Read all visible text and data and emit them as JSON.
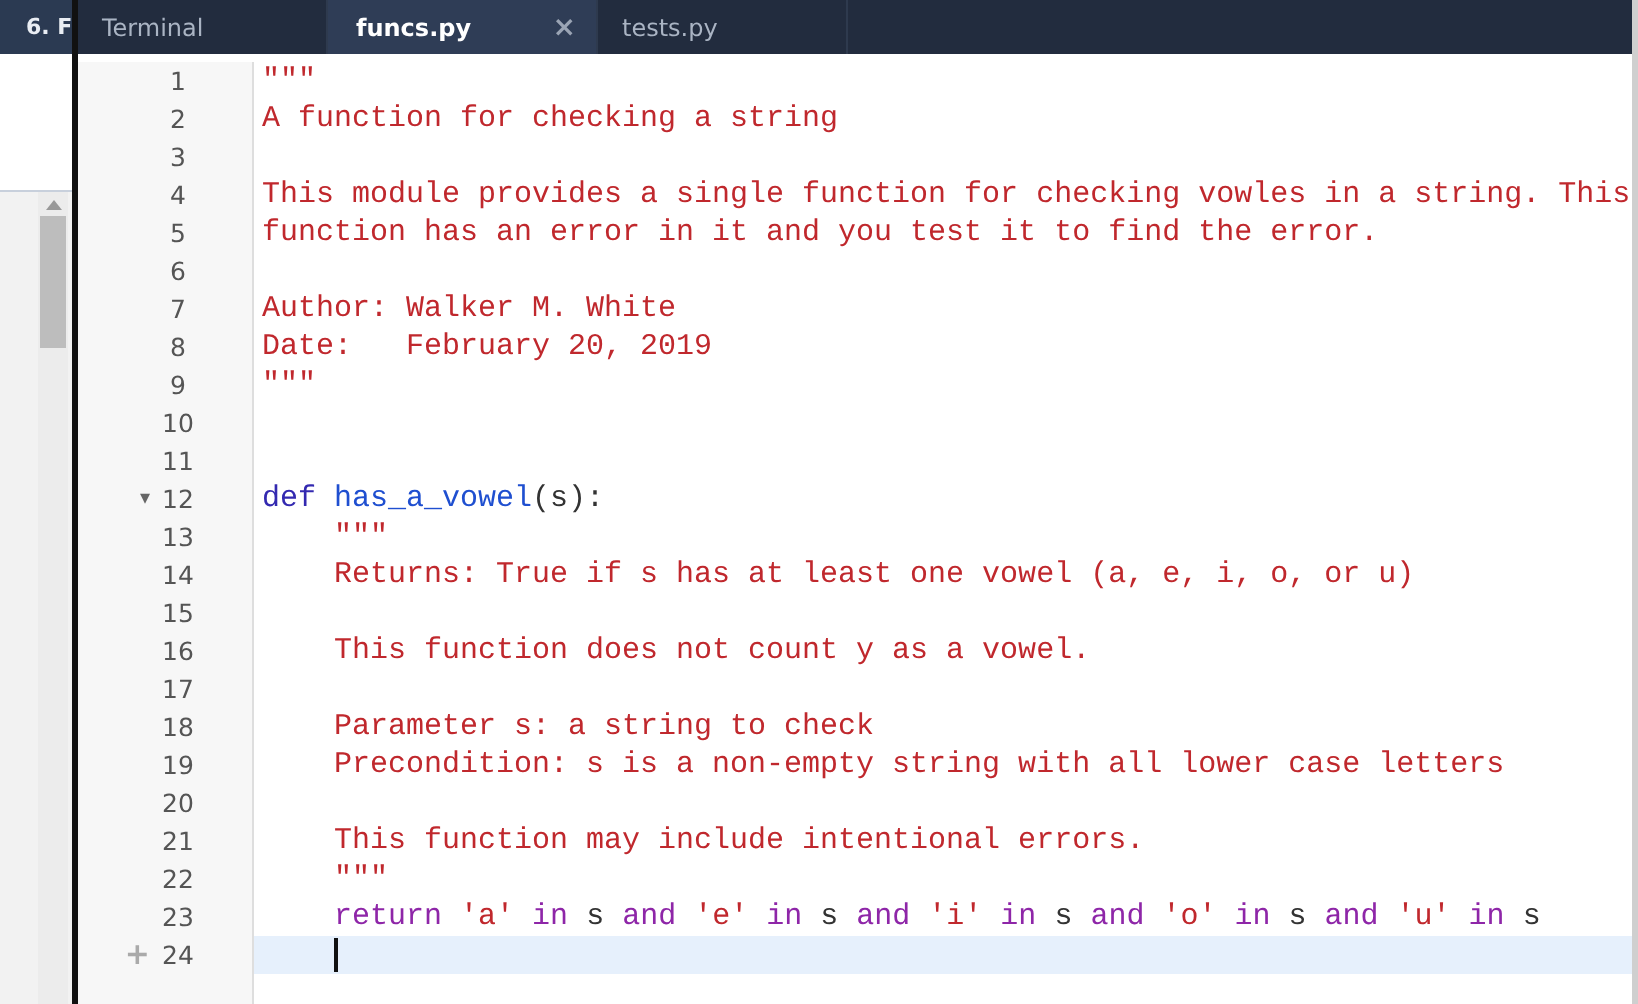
{
  "background_window": {
    "title": "6. F"
  },
  "tabs": [
    {
      "label": "Terminal",
      "selected": false
    },
    {
      "label": "funcs.py",
      "selected": true,
      "close": "×"
    },
    {
      "label": "tests.py",
      "selected": false
    }
  ],
  "lines": [
    {
      "number": "1",
      "current": false,
      "tokens": [
        {
          "kind": "string",
          "text": "\"\"\""
        }
      ]
    },
    {
      "number": "2",
      "current": false,
      "tokens": [
        {
          "kind": "string",
          "text": "A function for checking a string"
        }
      ]
    },
    {
      "number": "3",
      "current": false
    },
    {
      "number": "4",
      "current": false,
      "tokens": [
        {
          "kind": "string",
          "text": "This module provides a single function for checking vowles in a string. This"
        }
      ]
    },
    {
      "number": "5",
      "current": false,
      "tokens": [
        {
          "kind": "string",
          "text": "function has an error in it and you test it to find the error."
        }
      ]
    },
    {
      "number": "6",
      "current": false
    },
    {
      "number": "7",
      "current": false,
      "tokens": [
        {
          "kind": "string",
          "text": "Author: Walker M. White"
        }
      ]
    },
    {
      "number": "8",
      "current": false,
      "tokens": [
        {
          "kind": "string",
          "text": "Date:   February 20, 2019"
        }
      ]
    },
    {
      "number": "9",
      "current": false,
      "tokens": [
        {
          "kind": "string",
          "text": "\"\"\""
        }
      ]
    },
    {
      "number": "10",
      "current": false
    },
    {
      "number": "11",
      "current": false
    },
    {
      "number": "12",
      "current": false,
      "marker": "▾",
      "tokens": [
        {
          "kind": "def",
          "text": "def "
        },
        {
          "kind": "function",
          "text": "has_a_vowel"
        },
        {
          "kind": "plain",
          "text": "(s):"
        }
      ]
    },
    {
      "number": "13",
      "current": false,
      "tokens": [
        {
          "kind": "string",
          "text": "    \"\"\""
        }
      ]
    },
    {
      "number": "14",
      "current": false,
      "tokens": [
        {
          "kind": "string",
          "text": "    Returns: True if s has at least one vowel (a, e, i, o, or u)"
        }
      ]
    },
    {
      "number": "15",
      "current": false
    },
    {
      "number": "16",
      "current": false,
      "tokens": [
        {
          "kind": "string",
          "text": "    This function does not count y as a vowel."
        }
      ]
    },
    {
      "number": "17",
      "current": false
    },
    {
      "number": "18",
      "current": false,
      "tokens": [
        {
          "kind": "string",
          "text": "    Parameter s: a string to check"
        }
      ]
    },
    {
      "number": "19",
      "current": false,
      "tokens": [
        {
          "kind": "string",
          "text": "    Precondition: s is a non-empty string with all lower case letters"
        }
      ]
    },
    {
      "number": "20",
      "current": false
    },
    {
      "number": "21",
      "current": false,
      "tokens": [
        {
          "kind": "string",
          "text": "    This function may include intentional errors."
        }
      ]
    },
    {
      "number": "22",
      "current": false,
      "tokens": [
        {
          "kind": "string",
          "text": "    \"\"\""
        }
      ]
    },
    {
      "number": "23",
      "current": false,
      "tokens": [
        {
          "kind": "keyword",
          "text": "    return "
        },
        {
          "kind": "string",
          "text": "'a' "
        },
        {
          "kind": "keyword",
          "text": "in"
        },
        {
          "kind": "plain",
          "text": " s "
        },
        {
          "kind": "keyword",
          "text": "and "
        },
        {
          "kind": "string",
          "text": "'e' "
        },
        {
          "kind": "keyword",
          "text": "in"
        },
        {
          "kind": "plain",
          "text": " s "
        },
        {
          "kind": "keyword",
          "text": "and "
        },
        {
          "kind": "string",
          "text": "'i' "
        },
        {
          "kind": "keyword",
          "text": "in"
        },
        {
          "kind": "plain",
          "text": " s "
        },
        {
          "kind": "keyword",
          "text": "and "
        },
        {
          "kind": "string",
          "text": "'o' "
        },
        {
          "kind": "keyword",
          "text": "in"
        },
        {
          "kind": "plain",
          "text": " s "
        },
        {
          "kind": "keyword",
          "text": "and "
        },
        {
          "kind": "string",
          "text": "'u' "
        },
        {
          "kind": "keyword",
          "text": "in"
        },
        {
          "kind": "plain",
          "text": " s"
        }
      ]
    },
    {
      "number": "24",
      "current": true,
      "marker": "+"
    }
  ]
}
